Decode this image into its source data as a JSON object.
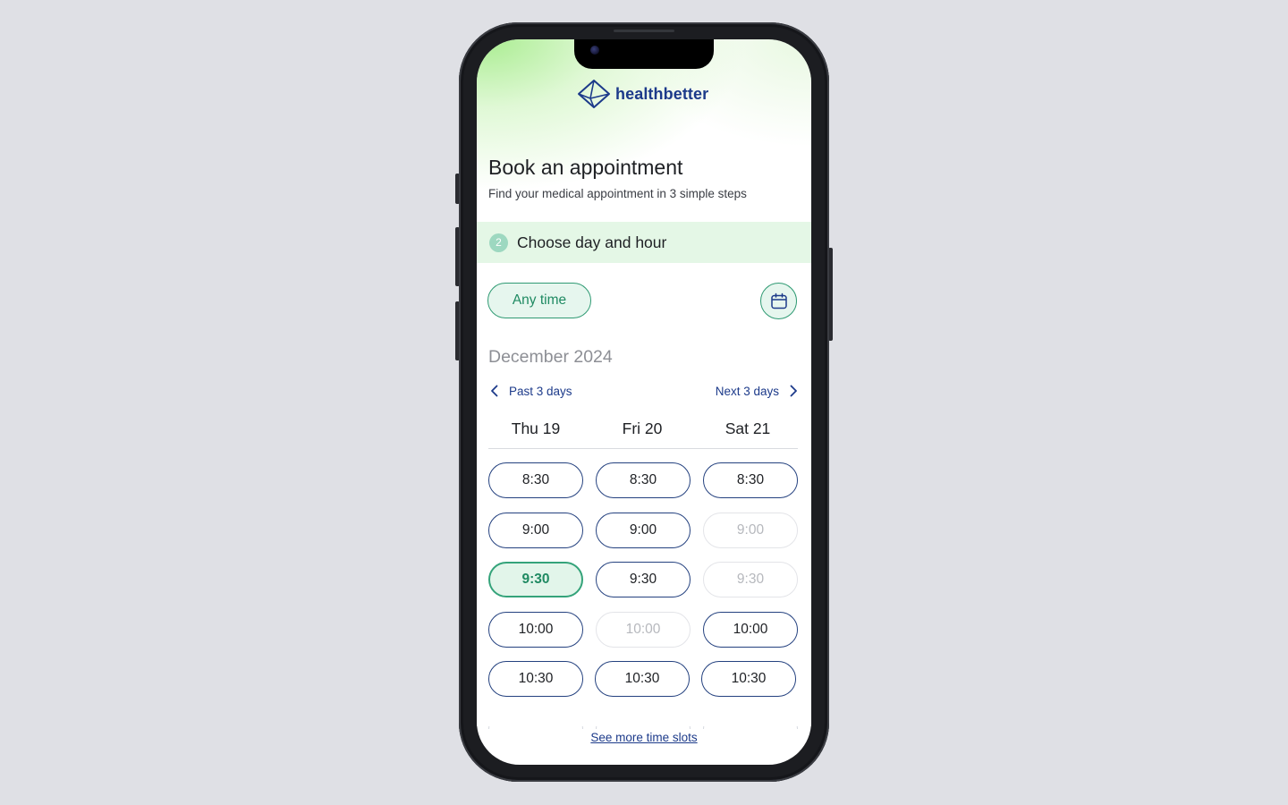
{
  "brand": {
    "name": "healthbetter",
    "color": "#1c3a8a"
  },
  "header": {
    "title": "Book an appointment",
    "subtitle": "Find your medical appointment in 3 simple steps"
  },
  "step": {
    "number": "2",
    "title": "Choose day and hour"
  },
  "filters": {
    "any_time_label": "Any time",
    "calendar_icon": "calendar-icon"
  },
  "calendar": {
    "month": "December 2024",
    "prev_label": "Past 3 days",
    "next_label": "Next 3 days",
    "days": [
      {
        "label": "Thu 19",
        "slots": [
          {
            "time": "8:30",
            "state": "available"
          },
          {
            "time": "9:00",
            "state": "available"
          },
          {
            "time": "9:30",
            "state": "selected"
          },
          {
            "time": "10:00",
            "state": "available"
          },
          {
            "time": "10:30",
            "state": "available"
          }
        ]
      },
      {
        "label": "Fri 20",
        "slots": [
          {
            "time": "8:30",
            "state": "available"
          },
          {
            "time": "9:00",
            "state": "available"
          },
          {
            "time": "9:30",
            "state": "available"
          },
          {
            "time": "10:00",
            "state": "unavailable"
          },
          {
            "time": "10:30",
            "state": "available"
          }
        ]
      },
      {
        "label": "Sat 21",
        "slots": [
          {
            "time": "8:30",
            "state": "available"
          },
          {
            "time": "9:00",
            "state": "unavailable"
          },
          {
            "time": "9:30",
            "state": "unavailable"
          },
          {
            "time": "10:00",
            "state": "available"
          },
          {
            "time": "10:30",
            "state": "available"
          }
        ]
      }
    ]
  },
  "footer": {
    "see_more_label": "See more time slots"
  },
  "colors": {
    "accent_green": "#2f9a73",
    "selected_bg": "#e2f5ea",
    "slot_border": "#24417f",
    "step_band": "#e4f7e6"
  }
}
